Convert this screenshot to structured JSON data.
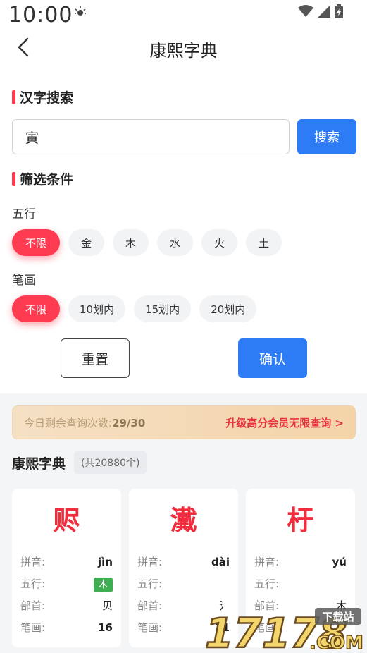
{
  "status_bar": {
    "time": "10:00"
  },
  "header": {
    "title": "康熙字典"
  },
  "search": {
    "section_title": "汉字搜索",
    "input_value": "寅",
    "button_label": "搜索"
  },
  "filters": {
    "section_title": "筛选条件",
    "wuxing": {
      "label": "五行",
      "options": [
        "不限",
        "金",
        "木",
        "水",
        "火",
        "土"
      ],
      "selected": "不限"
    },
    "strokes": {
      "label": "笔画",
      "options": [
        "不限",
        "10划内",
        "15划内",
        "20划内"
      ],
      "selected": "不限"
    },
    "reset_label": "重置",
    "confirm_label": "确认"
  },
  "quota": {
    "text": "今日剩余查询次数:",
    "count": "29/30",
    "upgrade_link": "升级高分会员无限查询 >"
  },
  "list": {
    "title": "康熙字典",
    "count": "(共20880个)",
    "keys": {
      "pinyin": "拼音:",
      "wuxing": "五行:",
      "radical": "部首:",
      "strokes": "笔画:"
    },
    "cards": [
      {
        "char": "赆",
        "pinyin": "jìn",
        "wuxing": "木",
        "radical": "贝",
        "strokes": "16"
      },
      {
        "char": "瀻",
        "pinyin": "dài",
        "wuxing": "",
        "radical": "氵",
        "strokes": "21"
      },
      {
        "char": "杅",
        "pinyin": "yú",
        "wuxing": "",
        "radical": "木",
        "strokes": "7"
      }
    ]
  },
  "watermark": {
    "text": "17178",
    "domain": ".COM",
    "tag": "下载站"
  },
  "colors": {
    "accent_red": "#ff3b52",
    "primary_blue": "#2d7cf6",
    "wuxing_green": "#3fae52"
  }
}
